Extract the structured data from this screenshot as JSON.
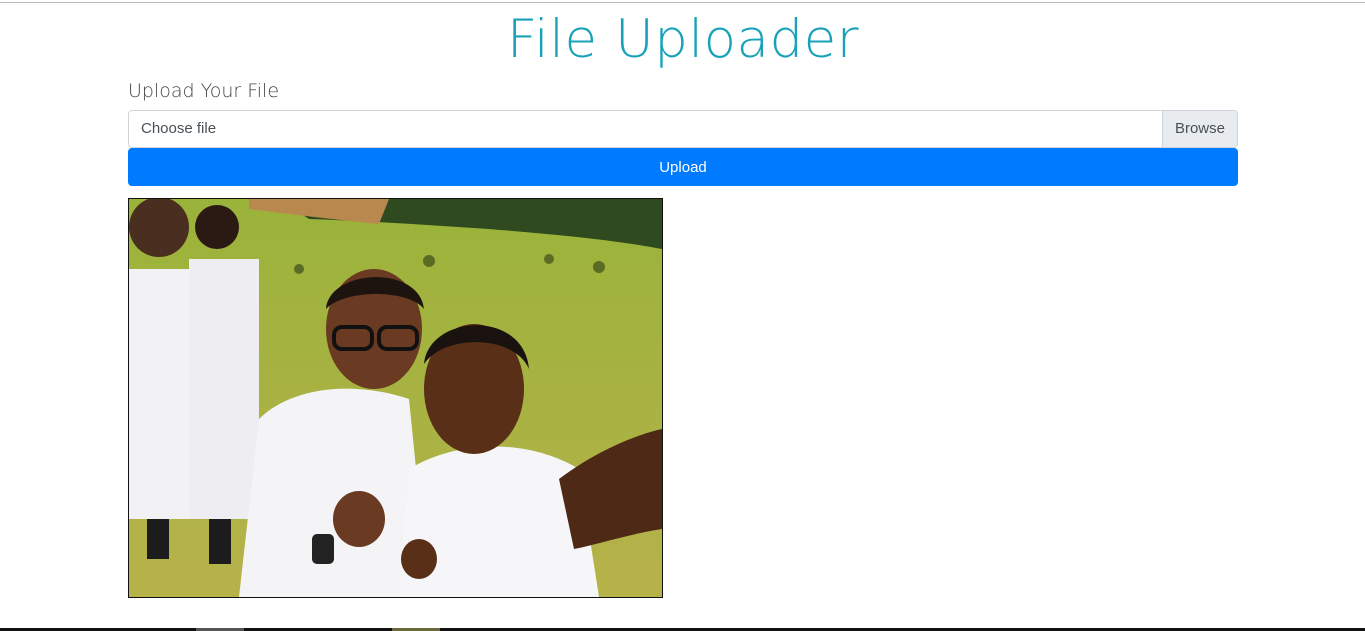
{
  "page": {
    "title": "File Uploader"
  },
  "form": {
    "label": "Upload Your File",
    "file_placeholder": "Choose file",
    "browse_label": "Browse",
    "upload_label": "Upload"
  },
  "colors": {
    "title": "#17a2b8",
    "primary": "#007bff",
    "browse_bg": "#e9ecef"
  },
  "preview": {
    "alt": "uploaded photo preview"
  }
}
